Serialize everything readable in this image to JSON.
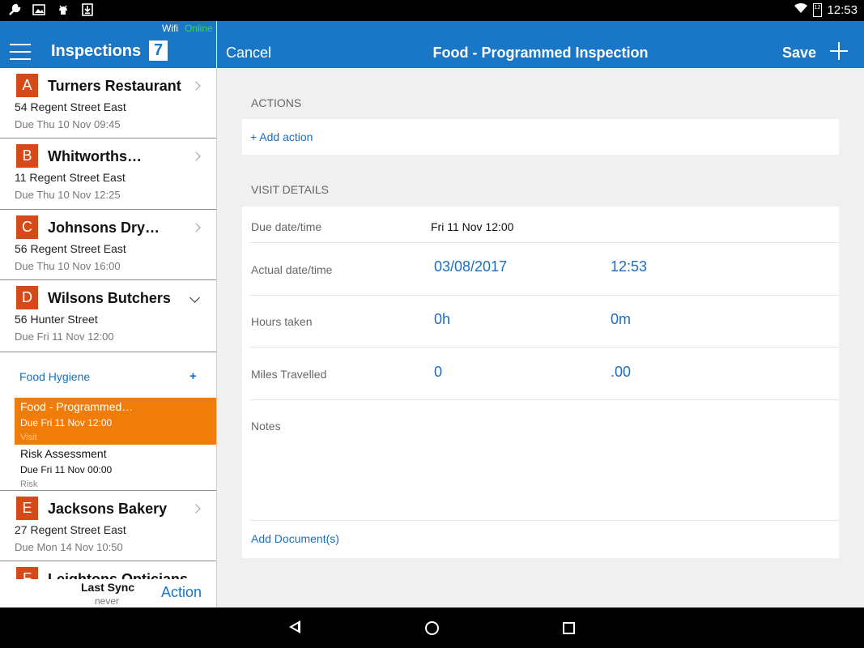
{
  "status_bar": {
    "time": "12:53",
    "battery_level": "12"
  },
  "header": {
    "app_title": "Inspections",
    "inspection_count": "7",
    "wifi_label": "Wifi",
    "online_label": "Online",
    "cancel_label": "Cancel",
    "page_title": "Food - Programmed Inspection",
    "save_label": "Save"
  },
  "inspections": [
    {
      "letter": "A",
      "name": "Turners Restaurant",
      "address": "54 Regent Street East",
      "due": "Due Thu 10 Nov 09:45"
    },
    {
      "letter": "B",
      "name": "Whitworths…",
      "address": "11 Regent Street East",
      "due": "Due Thu 10 Nov 12:25"
    },
    {
      "letter": "C",
      "name": "Johnsons Dry…",
      "address": "56 Regent Street East",
      "due": "Due Thu 10 Nov 16:00"
    },
    {
      "letter": "D",
      "name": "Wilsons Butchers",
      "address": "56 Hunter Street",
      "due": "Due Fri 11 Nov 12:00"
    },
    {
      "letter": "E",
      "name": "Jacksons Bakery",
      "address": "27 Regent Street East",
      "due": "Due Mon 14 Nov 10:50"
    },
    {
      "letter": "F",
      "name": "Leightons Opticians",
      "address": "",
      "due": ""
    }
  ],
  "expanded": {
    "category": "Food Hygiene",
    "add_symbol": "+",
    "tasks": [
      {
        "title": "Food - Programmed…",
        "due": "Due Fri 11 Nov 12:00",
        "type": "Visit"
      },
      {
        "title": "Risk Assessment",
        "due": "Due Fri 11 Nov 00:00",
        "type": "Risk"
      }
    ]
  },
  "sync": {
    "label": "Last Sync",
    "value": "never",
    "action_label": "Action"
  },
  "actions_section": {
    "heading": "ACTIONS",
    "add_action_label": "+ Add action"
  },
  "visit_details": {
    "heading": "VISIT DETAILS",
    "due_label": "Due date/time",
    "due_value": "Fri 11 Nov 12:00",
    "actual_label": "Actual date/time",
    "actual_date": "03/08/2017",
    "actual_time": "12:53",
    "hours_label": "Hours taken",
    "hours_value": "0h",
    "minutes_value": "0m",
    "miles_label": "Miles Travelled",
    "miles_value": "0",
    "miles_decimal": ".00",
    "notes_label": "Notes",
    "add_document_label": "Add Document(s)"
  },
  "colors": {
    "accent": "#1a76c6",
    "selected": "#f07d0a",
    "letter_badge": "#d64a1a",
    "online": "#3cdc3c"
  }
}
